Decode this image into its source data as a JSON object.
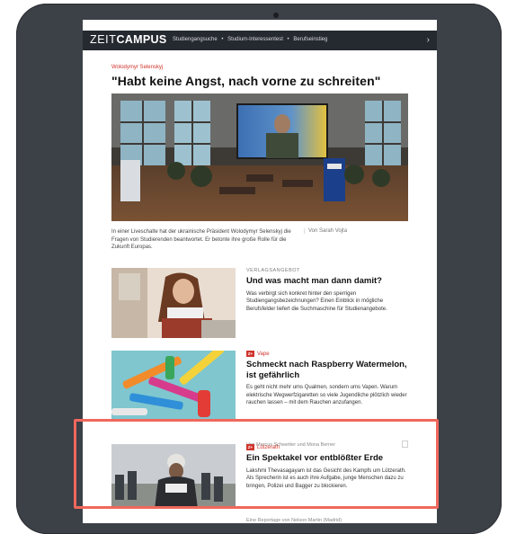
{
  "nav": {
    "logo_light": "ZEIT",
    "logo_bold": "CAMPUS",
    "links": [
      "Studiengangsuche",
      "Studium-Interessentest",
      "Berufseinstieg"
    ],
    "separator": "•"
  },
  "lead": {
    "kicker": "Wolodymyr Selenskyj",
    "headline": "\"Habt keine Angst, nach vorne zu schreiten\"",
    "caption": "In einer Liveschalte hat der ukrainische Präsident Wolodymyr Selenskyj die Fragen von Studierenden beantwortet. Er betonte ihre große Rolle für die Zukunft Europas.",
    "author": "Von Sarah Vojta"
  },
  "articles": [
    {
      "label": "VERLAGSANGEBOT",
      "title": "Und was macht man dann damit?",
      "summary": "Was verbirgt sich konkret hinter den sperrigen Studiengangsbezeichnungen? Einen Einblick in mögliche Berufsfelder liefert die Suchmaschine für Studienangebote."
    },
    {
      "tag_badge": "Z+",
      "tag": "Vape",
      "title": "Schmeckt nach Raspberry Watermelon, ist gefährlich",
      "summary": "Es geht nicht mehr ums Qualmen, sondern ums Vapen. Warum elektrische Wegwerfzigaretten so viele Jugendliche plötzlich wieder rauchen lassen – mit dem Rauchen anzufangen.",
      "byline": "Von Marcus Schwetter und Mona Berner"
    },
    {
      "tag_badge": "Z+",
      "tag": "Lützerath",
      "title": "Ein Spektakel vor entblößter Erde",
      "summary": "Lakshmi Thevasagayam ist das Gesicht des Kampfs um Lützerath. Als Sprecherin ist es auch ihre Aufgabe, junge Menschen dazu zu bringen, Polizei und Bagger zu blockieren.",
      "byline": "Eine Reportage von Nelson Martin (Madrid)"
    }
  ],
  "colors": {
    "accent": "#d0342c",
    "nav_bg": "#252a30",
    "highlight": "#f0685c",
    "frame": "#3c4047"
  }
}
